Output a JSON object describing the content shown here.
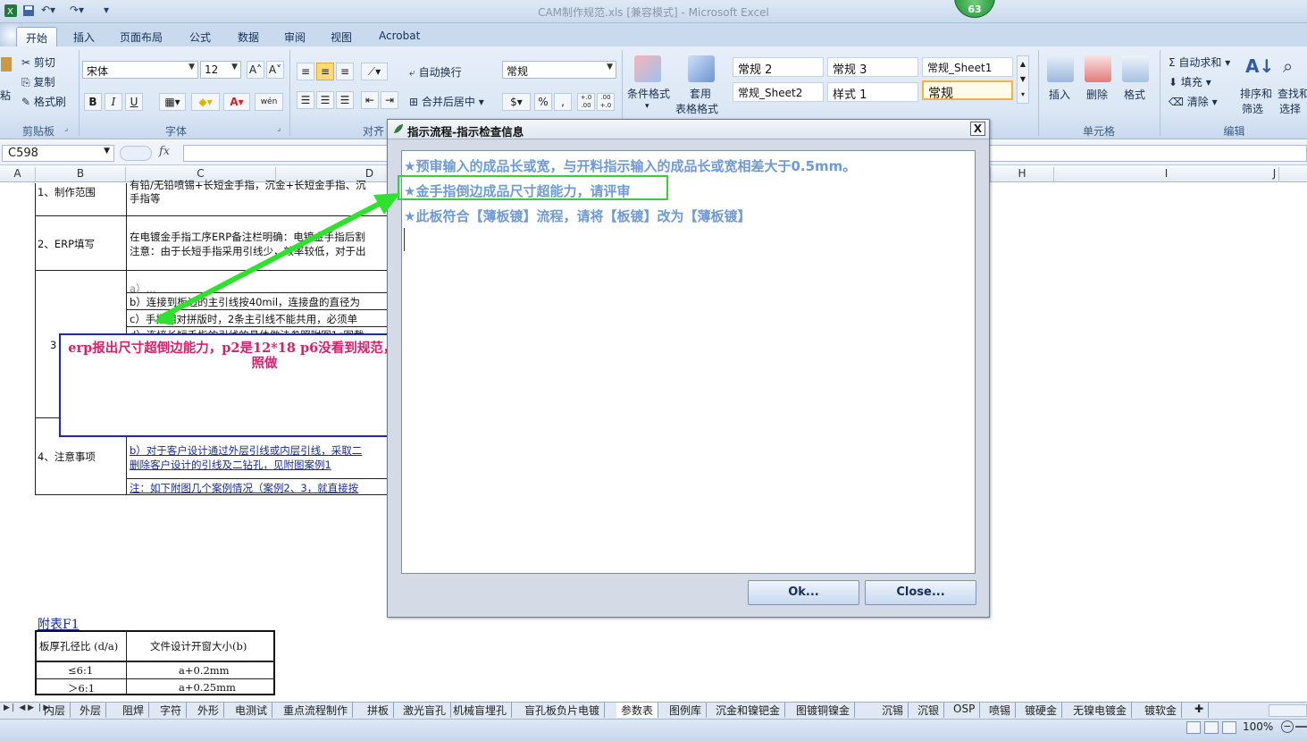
{
  "window": {
    "title": "CAM制作规范.xls  [兼容模式] - Microsoft Excel",
    "badge": "63"
  },
  "ribbon_tabs": [
    "开始",
    "插入",
    "页面布局",
    "公式",
    "数据",
    "审阅",
    "视图",
    "Acrobat"
  ],
  "clipboard": {
    "cut": "剪切",
    "copy": "复制",
    "format_painter": "格式刷",
    "paste": "粘",
    "group": "剪贴板"
  },
  "font": {
    "name": "宋体",
    "size": "12",
    "group": "字体",
    "grow": "A˄",
    "shrink": "A˅",
    "bold": "B",
    "italic": "I",
    "underline": "U",
    "phonetic": "wén"
  },
  "alignment": {
    "wrap": "自动换行",
    "merge": "合并后居中",
    "group": "对齐"
  },
  "number": {
    "format": "常规",
    "percent": "%",
    "comma": ",",
    "inc": "+.0 .00",
    "dec": ".00 +.0"
  },
  "styles": {
    "conditional": "条件格式",
    "table_line1": "套用",
    "table_line2": "表格格式",
    "cells": [
      "常规 2",
      "常规 3",
      "常规_Sheet1",
      "常规_Sheet2",
      "样式 1",
      "常规"
    ]
  },
  "cells_group": {
    "insert": "插入",
    "delete": "删除",
    "format": "格式",
    "group": "单元格"
  },
  "editing": {
    "autosum": "自动求和",
    "fill": "填充",
    "clear": "清除",
    "sort": "排序和",
    "sort2": "筛选",
    "find": "查找和",
    "find2": "选择",
    "group": "编辑"
  },
  "formula_bar": {
    "name_box": "C598",
    "fx": "fx"
  },
  "columns": [
    "A",
    "B",
    "C",
    "D",
    "H",
    "I",
    "J"
  ],
  "sheet": {
    "rows": [
      {
        "label": "1、制作范围",
        "lines": [
          "有铅/无铅喷锡+长短金手指，沉金+长短金手指、沉",
          "手指等"
        ]
      },
      {
        "label": "2、ERP填写",
        "lines": [
          "在电镀金手指工序ERP备注栏明确：电镀金手指后割",
          "注意：由于长短手指采用引线少，效率较低，对于出"
        ]
      },
      {
        "label": "3",
        "lines": [
          "a）...",
          "b）连接到板边的主引线按40mil，连接盘的直径为",
          "c）手指相对拼版时，2条主引线不能共用，必须单",
          "d）连接长短手指的引线的具体做法参照附图1c图截"
        ]
      },
      {
        "label": "4、注意事项",
        "lines": [
          "b）对于客户设计通过外层引线或内层引线，采取二",
          "删除客户设计的引线及二钻孔，见附图案例1",
          "注：如下附图几个案例情况（案例2、3，就直接按"
        ]
      }
    ],
    "appendix_title": "附表F1",
    "appendix_headers": [
      "板厚孔径比 (d/a)",
      "文件设计开窗大小(b)"
    ],
    "appendix_rows": [
      [
        "≤6:1",
        "a+0.2mm"
      ],
      [
        "＞6:1",
        "a+0.25mm"
      ]
    ]
  },
  "dialog": {
    "title": "指示流程-指示检查信息",
    "close_glyph": "X",
    "messages": [
      "★预审输入的成品长或宽，与开料指示输入的成品长或宽相差大于0.5mm。",
      "★金手指倒边成品尺寸超能力，请评审",
      "★此板符合【薄板镀】流程，请将【板镀】改为【薄板镀】"
    ],
    "ok": "Ok...",
    "close": "Close..."
  },
  "annotation": {
    "text": "erp报出尺寸超倒边能力，p2是12*18  p6没看到规范，请确认是否照做"
  },
  "sheet_tabs": [
    "内层",
    "外层",
    "阻焊",
    "字符",
    "外形",
    "电测试",
    "重点流程制作",
    "拼板",
    "激光盲孔",
    "机械盲埋孔",
    "盲孔板负片电镀",
    "参数表",
    "图例库",
    "沉金和镍钯金",
    "图镀铜镍金",
    "沉锡",
    "沉银",
    "OSP",
    "喷锡",
    "镀硬金",
    "无镍电镀金",
    "镀软金"
  ],
  "status": {
    "zoom": "100%"
  }
}
